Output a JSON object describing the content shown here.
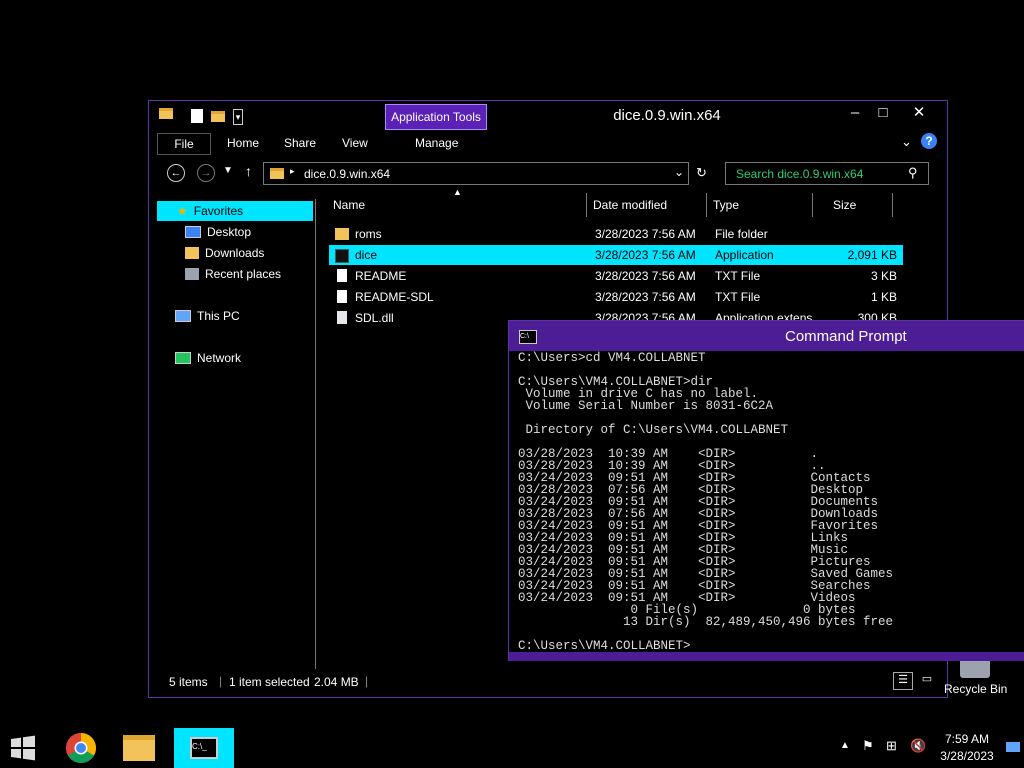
{
  "explorer": {
    "title": "dice.0.9.win.x64",
    "app_tools": "Application Tools",
    "tabs": [
      "File",
      "Home",
      "Share",
      "View",
      "Manage"
    ],
    "address": "dice.0.9.win.x64",
    "search_placeholder": "Search dice.0.9.win.x64",
    "nav": {
      "favorites": "Favorites",
      "desktop": "Desktop",
      "downloads": "Downloads",
      "recent": "Recent places",
      "this_pc": "This PC",
      "network": "Network"
    },
    "columns": {
      "name": "Name",
      "date": "Date modified",
      "type": "Type",
      "size": "Size"
    },
    "files": [
      {
        "name": "roms",
        "date": "3/28/2023 7:56 AM",
        "type": "File folder",
        "size": ""
      },
      {
        "name": "dice",
        "date": "3/28/2023 7:56 AM",
        "type": "Application",
        "size": "2,091 KB"
      },
      {
        "name": "README",
        "date": "3/28/2023 7:56 AM",
        "type": "TXT File",
        "size": "3 KB"
      },
      {
        "name": "README-SDL",
        "date": "3/28/2023 7:56 AM",
        "type": "TXT File",
        "size": "1 KB"
      },
      {
        "name": "SDL.dll",
        "date": "3/28/2023 7:56 AM",
        "type": "Application extens",
        "size": "300 KB"
      }
    ],
    "status": {
      "items": "5 items",
      "selected": "1 item selected",
      "size": "2.04 MB"
    }
  },
  "cmd": {
    "title": "Command Prompt",
    "text": "C:\\Users>cd VM4.COLLABNET\n\nC:\\Users\\VM4.COLLABNET>dir\n Volume in drive C has no label.\n Volume Serial Number is 8031-6C2A\n\n Directory of C:\\Users\\VM4.COLLABNET\n\n03/28/2023  10:39 AM    <DIR>          .\n03/28/2023  10:39 AM    <DIR>          ..\n03/24/2023  09:51 AM    <DIR>          Contacts\n03/28/2023  07:56 AM    <DIR>          Desktop\n03/24/2023  09:51 AM    <DIR>          Documents\n03/28/2023  07:56 AM    <DIR>          Downloads\n03/24/2023  09:51 AM    <DIR>          Favorites\n03/24/2023  09:51 AM    <DIR>          Links\n03/24/2023  09:51 AM    <DIR>          Music\n03/24/2023  09:51 AM    <DIR>          Pictures\n03/24/2023  09:51 AM    <DIR>          Saved Games\n03/24/2023  09:51 AM    <DIR>          Searches\n03/24/2023  09:51 AM    <DIR>          Videos\n               0 File(s)              0 bytes\n              13 Dir(s)  82,489,450,496 bytes free\n\nC:\\Users\\VM4.COLLABNET>"
  },
  "desktop": {
    "recycle_bin": "Recycle Bin"
  },
  "taskbar": {
    "time": "7:59 AM",
    "date": "3/28/2023"
  }
}
